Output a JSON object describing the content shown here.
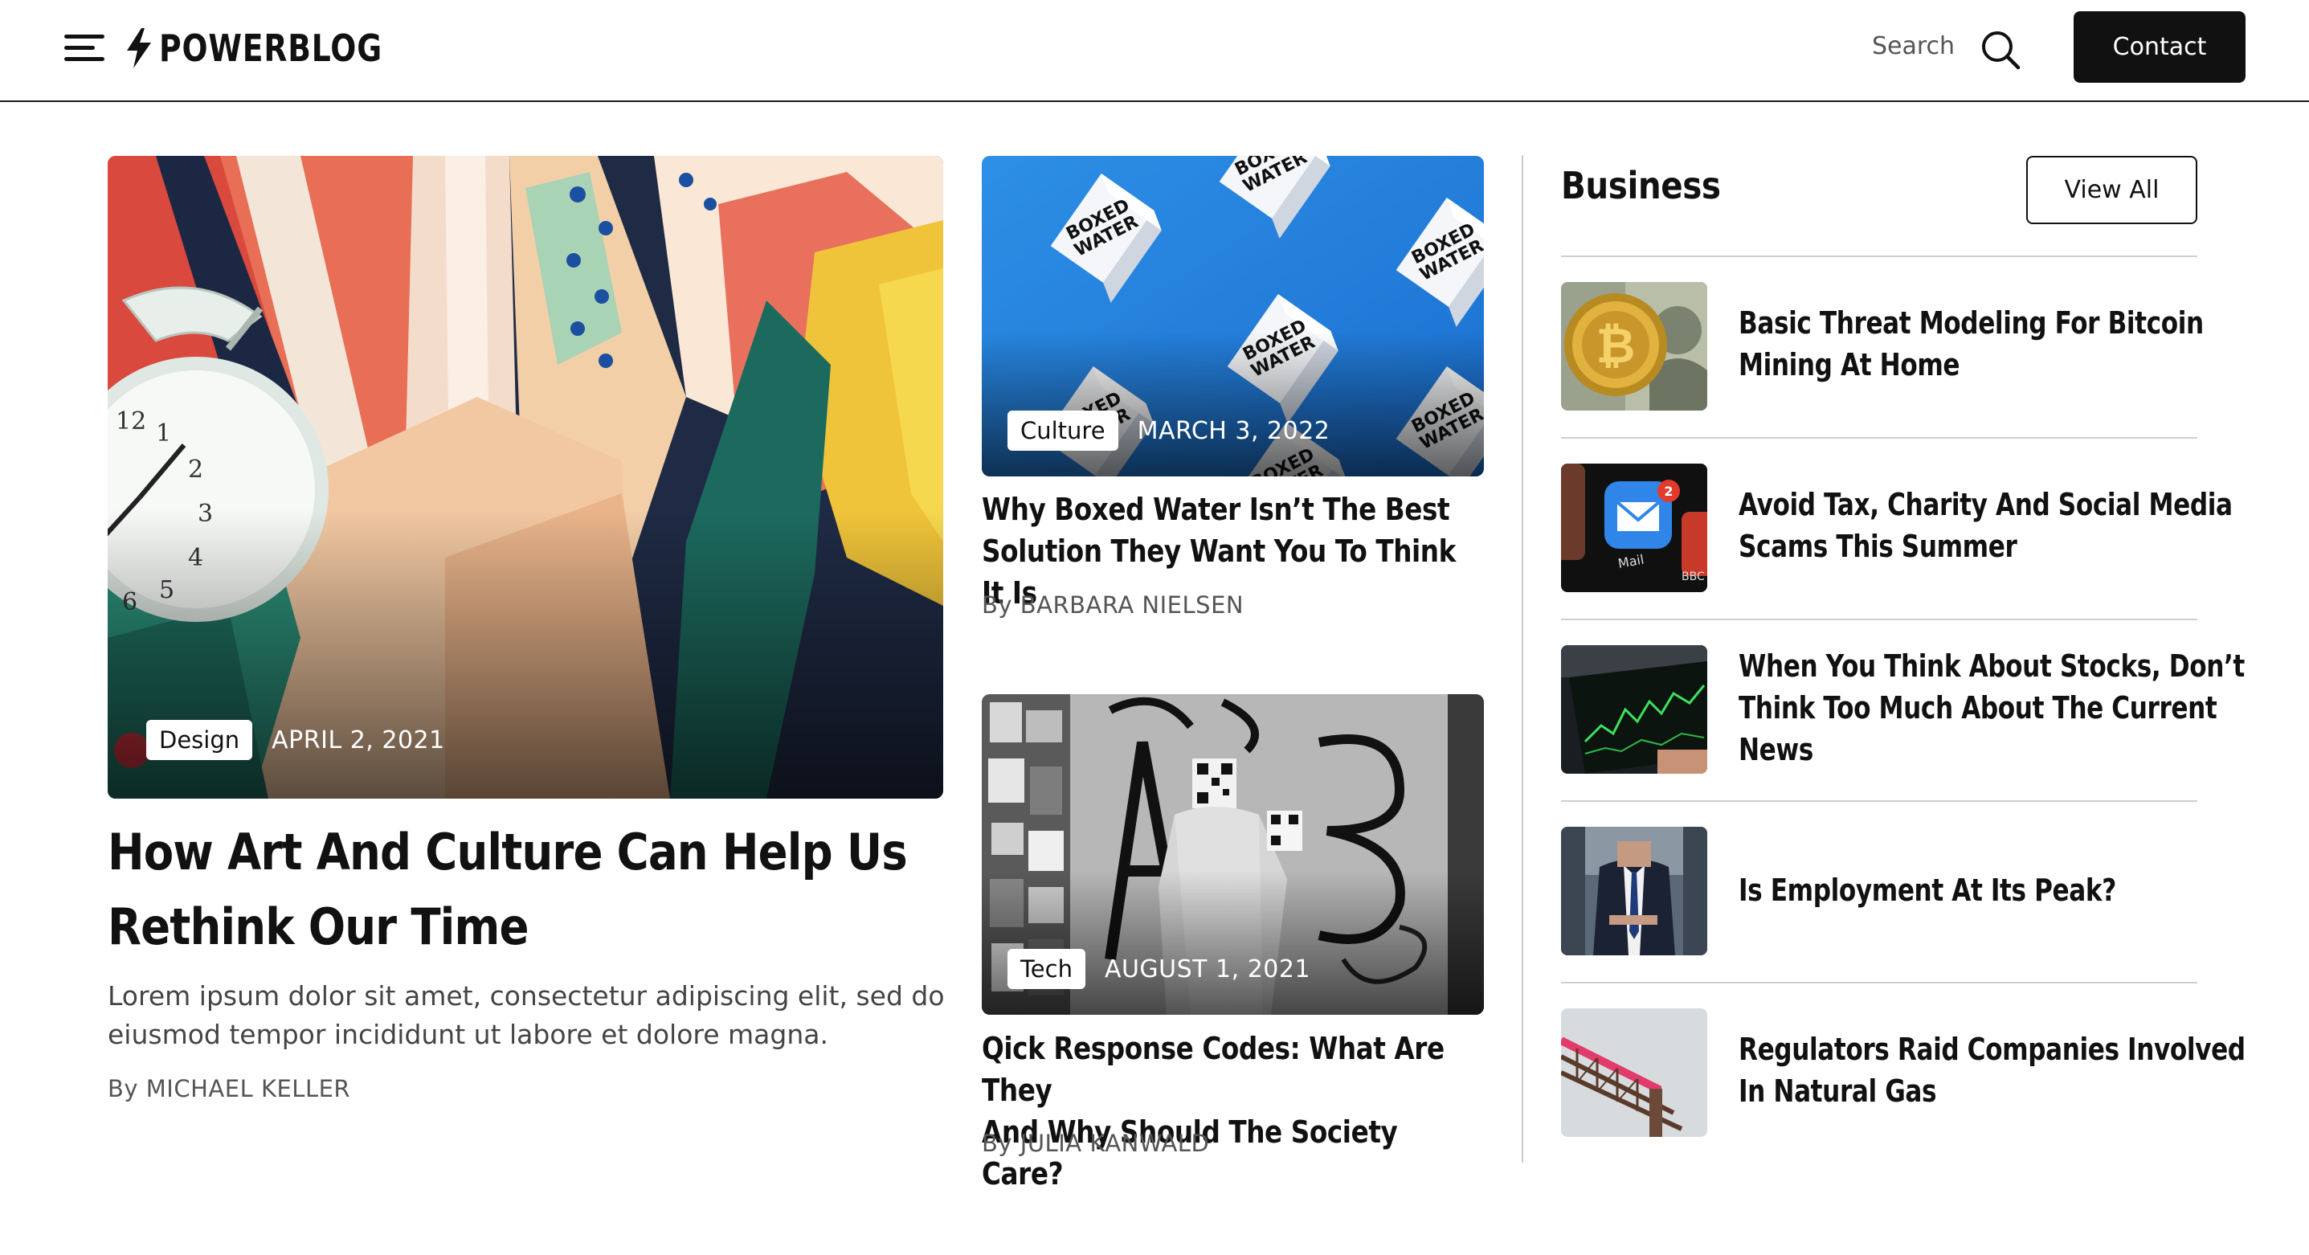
{
  "header": {
    "brand": "POWERBLOG",
    "search_label": "Search",
    "contact_label": "Contact"
  },
  "featured": {
    "tag": "Design",
    "date": "APRIL 2, 2021",
    "title_lines": [
      "How Art And Culture Can Help Us",
      "Rethink Our Time"
    ],
    "excerpt_lines": [
      "Lorem ipsum dolor sit amet, consectetur adipiscing elit, sed do",
      "eiusmod tempor incididunt ut labore et dolore magna."
    ],
    "by": "By",
    "author": "MICHAEL KELLER"
  },
  "articles": [
    {
      "tag": "Culture",
      "date": "MARCH 3, 2022",
      "title_lines": [
        "Why Boxed Water Isn’t The Best",
        "Solution They Want You To Think It Is"
      ],
      "by": "By",
      "author": "BARBARA NIELSEN",
      "carton_text": "BOXED WATER"
    },
    {
      "tag": "Tech",
      "date": "AUGUST 1, 2021",
      "title_lines": [
        "Qick Response Codes: What Are They",
        "And Why Should The Society Care?"
      ],
      "by": "By",
      "author": "JULIA KANWALD"
    }
  ],
  "sidebar": {
    "heading": "Business",
    "view_all_label": "View All",
    "items": [
      {
        "thumb_icon": "bitcoin-coin-image",
        "title_lines": [
          "Basic Threat Modeling For Bitcoin",
          "Mining At Home"
        ]
      },
      {
        "thumb_icon": "mail-app-image",
        "title_lines": [
          "Avoid Tax, Charity And Social Media",
          "Scams This Summer"
        ],
        "badge": "2",
        "app_label": "Mail",
        "app_label_2": "BBC"
      },
      {
        "thumb_icon": "stock-chart-image",
        "title_lines": [
          "When You Think About Stocks, Don’t",
          "Think Too Much About The Current",
          "News"
        ]
      },
      {
        "thumb_icon": "businessman-image",
        "title_lines": [
          "Is Employment At Its Peak?"
        ]
      },
      {
        "thumb_icon": "pipeline-image",
        "title_lines": [
          "Regulators Raid Companies Involved",
          "In Natural Gas"
        ]
      }
    ]
  },
  "colors": {
    "text": "#111111",
    "muted": "#555555",
    "button_dark": "#111111",
    "divider": "#cccccc"
  }
}
